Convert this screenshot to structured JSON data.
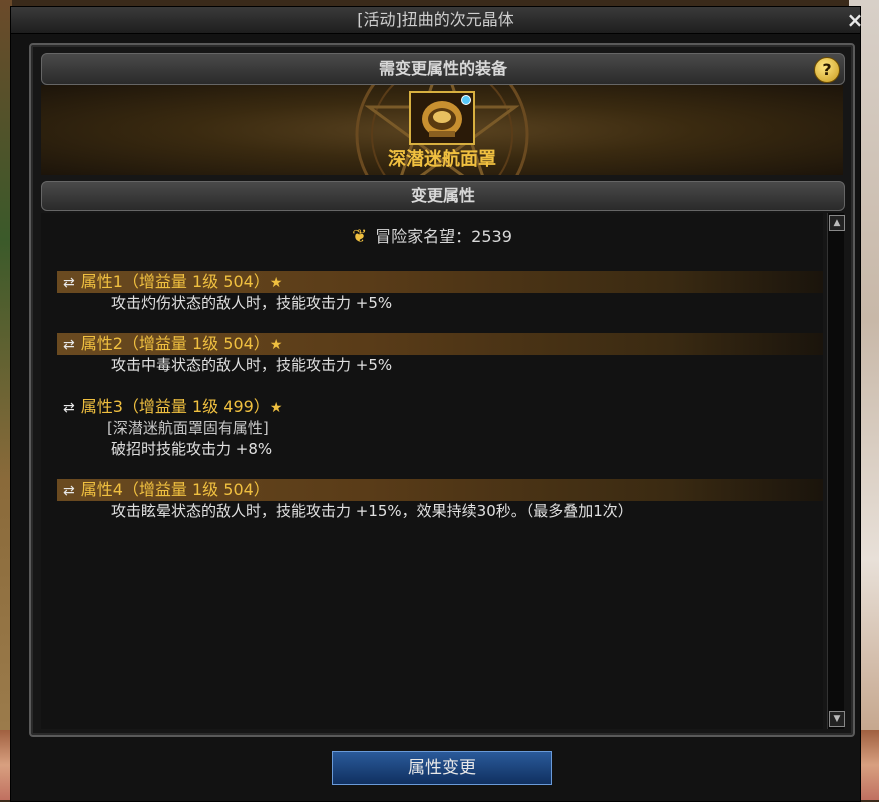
{
  "window": {
    "title": "[活动]扭曲的次元晶体",
    "close_label": "×"
  },
  "equip_section": {
    "header": "需变更属性的装备",
    "help_label": "?",
    "item_name": "深潜迷航面罩"
  },
  "change_section": {
    "header": "变更属性",
    "fame_label": "冒险家名望：2539",
    "attributes": [
      {
        "title": "属性1（增益量 1级 504）",
        "starred": true,
        "highlighted": true,
        "fixed_note": "",
        "desc": "攻击灼伤状态的敌人时，技能攻击力 +5%"
      },
      {
        "title": "属性2（增益量 1级 504）",
        "starred": true,
        "highlighted": true,
        "fixed_note": "",
        "desc": "攻击中毒状态的敌人时，技能攻击力 +5%"
      },
      {
        "title": "属性3（增益量 1级 499）",
        "starred": true,
        "highlighted": false,
        "fixed_note": "[深潜迷航面罩固有属性]",
        "desc": "破招时技能攻击力 +8%"
      },
      {
        "title": "属性4（增益量 1级 504）",
        "starred": false,
        "highlighted": true,
        "fixed_note": "",
        "desc": "攻击眩晕状态的敌人时，技能攻击力 +15%，效果持续30秒。（最多叠加1次）"
      }
    ]
  },
  "action_button": "属性变更",
  "icons": {
    "shuffle": "shuffle-icon",
    "star": "star-icon",
    "fame": "fame-icon",
    "help": "help-icon",
    "close": "close-icon"
  },
  "colors": {
    "gold": "#f0c040",
    "button": "#1e4a80"
  }
}
